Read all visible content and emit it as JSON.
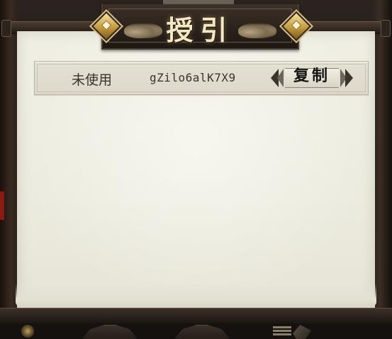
{
  "title": "授引",
  "codes": [
    {
      "status": "未使用",
      "code": "gZilo6alK7X9",
      "copy_label": "复制"
    }
  ],
  "icons": {
    "title_left": "gold-diamond-icon",
    "title_right": "gold-diamond-icon",
    "copy_left": "chevron-left-icon",
    "copy_right": "chevron-right-icon",
    "bottom_menu": "menu-icon"
  },
  "colors": {
    "parchment": "#eceadf",
    "frame": "#2a221c",
    "gold": "#c49a3e",
    "title_text": "#f4e7c6"
  }
}
